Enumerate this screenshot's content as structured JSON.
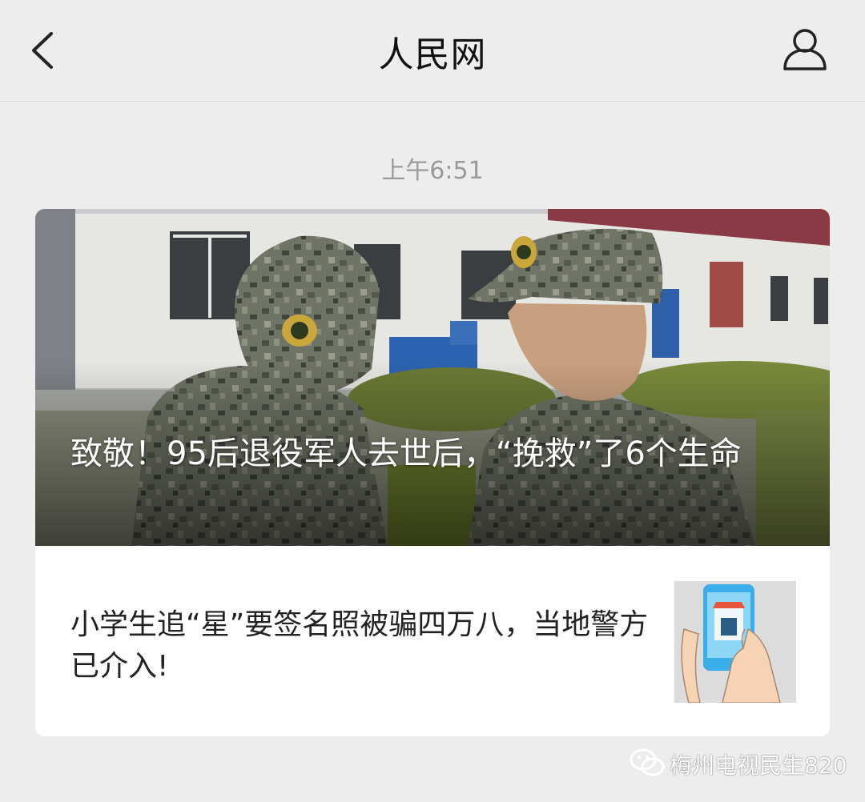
{
  "header": {
    "title": "人民网",
    "back_icon": "chevron-left-icon",
    "profile_icon": "person-icon"
  },
  "timestamp": "上午6:51",
  "articles": {
    "lead": {
      "title": "致敬！95后退役军人去世后，“挽救”了6个生命"
    },
    "items": [
      {
        "title": "小学生追“星”要签名照被骗四万八，当地警方已介入!"
      }
    ]
  },
  "watermark": {
    "text": "梅州电视民生820",
    "icon": "wechat-icon"
  },
  "colors": {
    "background": "#ededed",
    "card": "#ffffff",
    "timestamp": "#9a9a9a"
  }
}
